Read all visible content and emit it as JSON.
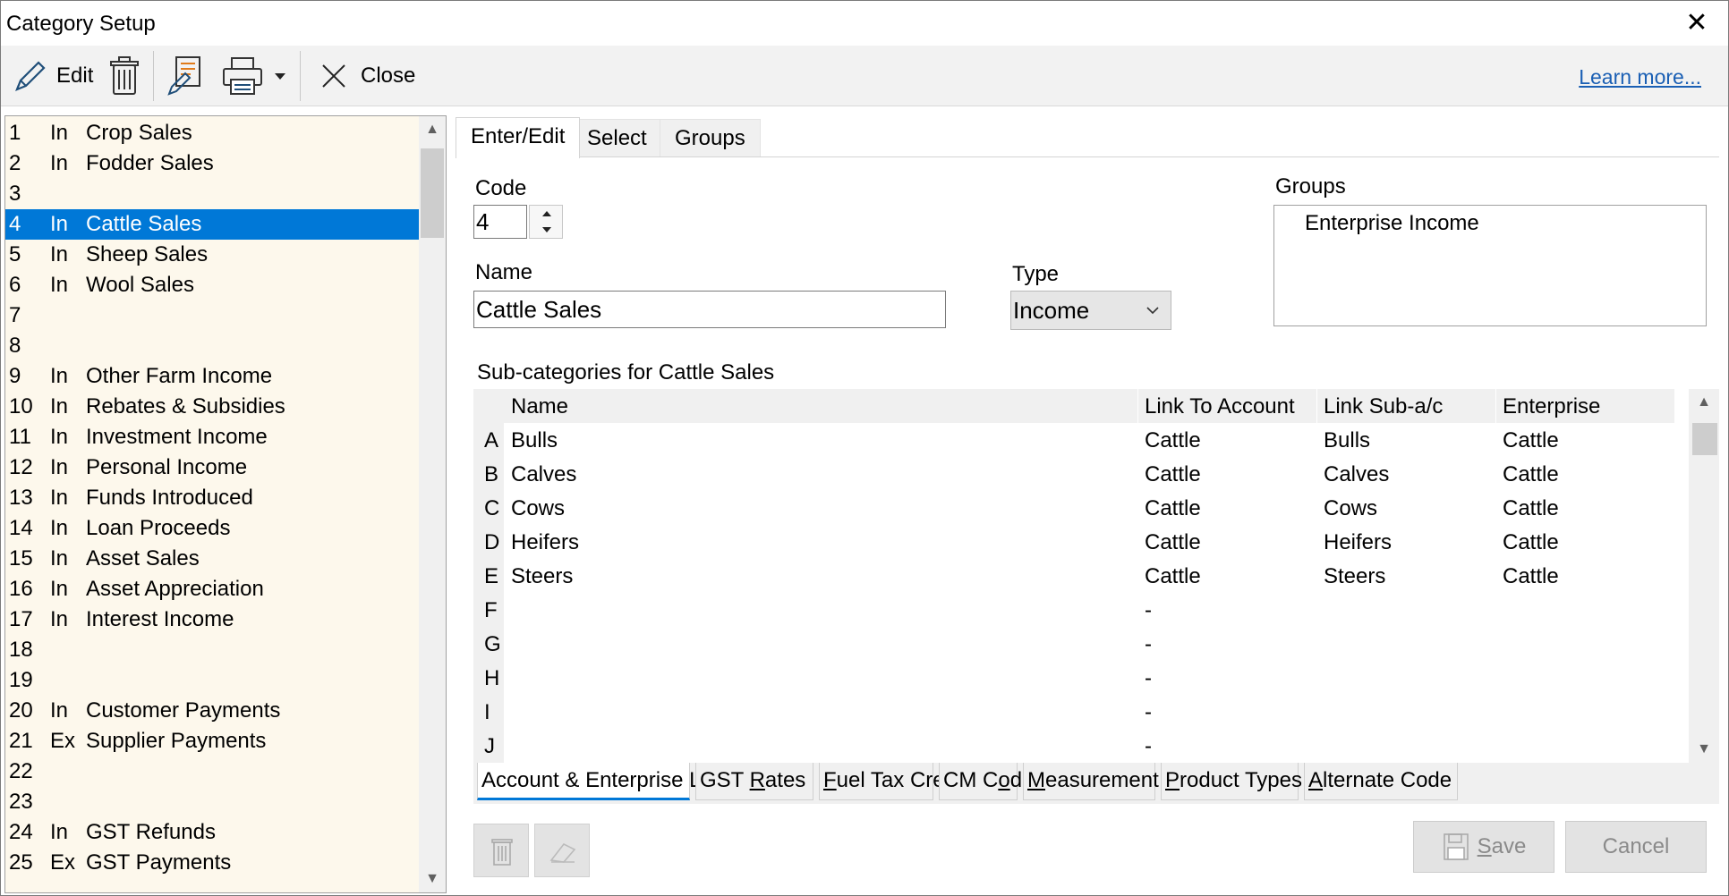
{
  "window": {
    "title": "Category Setup",
    "close_glyph": "✕"
  },
  "toolbar": {
    "edit_label": "Edit",
    "close_label": "Close",
    "learn_more": "Learn more..."
  },
  "categories": [
    {
      "num": "1",
      "type": "In",
      "name": "Crop Sales"
    },
    {
      "num": "2",
      "type": "In",
      "name": "Fodder Sales"
    },
    {
      "num": "3",
      "type": "",
      "name": ""
    },
    {
      "num": "4",
      "type": "In",
      "name": "Cattle Sales",
      "selected": true
    },
    {
      "num": "5",
      "type": "In",
      "name": "Sheep Sales"
    },
    {
      "num": "6",
      "type": "In",
      "name": "Wool Sales"
    },
    {
      "num": "7",
      "type": "",
      "name": ""
    },
    {
      "num": "8",
      "type": "",
      "name": ""
    },
    {
      "num": "9",
      "type": "In",
      "name": "Other Farm Income"
    },
    {
      "num": "10",
      "type": "In",
      "name": "Rebates & Subsidies"
    },
    {
      "num": "11",
      "type": "In",
      "name": "Investment Income"
    },
    {
      "num": "12",
      "type": "In",
      "name": "Personal Income"
    },
    {
      "num": "13",
      "type": "In",
      "name": "Funds Introduced"
    },
    {
      "num": "14",
      "type": "In",
      "name": "Loan Proceeds"
    },
    {
      "num": "15",
      "type": "In",
      "name": "Asset Sales"
    },
    {
      "num": "16",
      "type": "In",
      "name": "Asset Appreciation"
    },
    {
      "num": "17",
      "type": "In",
      "name": "Interest Income"
    },
    {
      "num": "18",
      "type": "",
      "name": ""
    },
    {
      "num": "19",
      "type": "",
      "name": ""
    },
    {
      "num": "20",
      "type": "In",
      "name": "Customer Payments"
    },
    {
      "num": "21",
      "type": "Ex",
      "name": "Supplier Payments"
    },
    {
      "num": "22",
      "type": "",
      "name": ""
    },
    {
      "num": "23",
      "type": "",
      "name": ""
    },
    {
      "num": "24",
      "type": "In",
      "name": "GST Refunds"
    },
    {
      "num": "25",
      "type": "Ex",
      "name": "GST Payments"
    }
  ],
  "tabs": [
    "Enter/Edit",
    "Select",
    "Groups"
  ],
  "form": {
    "code_label": "Code",
    "code_value": "4",
    "name_label": "Name",
    "name_value": "Cattle Sales",
    "type_label": "Type",
    "type_value": "Income",
    "groups_label": "Groups",
    "groups": [
      "Enterprise Income"
    ],
    "subcat_title": "Sub-categories for Cattle Sales"
  },
  "grid": {
    "headers": [
      "Name",
      "Link To Account",
      "Link Sub-a/c",
      "Enterprise"
    ],
    "rows": [
      {
        "letter": "A",
        "name": "Bulls",
        "account": "Cattle",
        "sub": "Bulls",
        "enterprise": "Cattle"
      },
      {
        "letter": "B",
        "name": "Calves",
        "account": "Cattle",
        "sub": "Calves",
        "enterprise": "Cattle"
      },
      {
        "letter": "C",
        "name": "Cows",
        "account": "Cattle",
        "sub": "Cows",
        "enterprise": "Cattle"
      },
      {
        "letter": "D",
        "name": "Heifers",
        "account": "Cattle",
        "sub": "Heifers",
        "enterprise": "Cattle"
      },
      {
        "letter": "E",
        "name": "Steers",
        "account": "Cattle",
        "sub": "Steers",
        "enterprise": "Cattle"
      },
      {
        "letter": "F",
        "name": "",
        "account": "-",
        "sub": "",
        "enterprise": ""
      },
      {
        "letter": "G",
        "name": "",
        "account": "-",
        "sub": "",
        "enterprise": ""
      },
      {
        "letter": "H",
        "name": "",
        "account": "-",
        "sub": "",
        "enterprise": ""
      },
      {
        "letter": "I",
        "name": "",
        "account": "-",
        "sub": "",
        "enterprise": ""
      },
      {
        "letter": "J",
        "name": "",
        "account": "-",
        "sub": "",
        "enterprise": ""
      }
    ]
  },
  "bottom_tabs": [
    {
      "pre": "Account & Enterprise Links",
      "ul": "",
      "post": ""
    },
    {
      "pre": "GST ",
      "ul": "R",
      "post": "ates"
    },
    {
      "pre": "",
      "ul": "F",
      "post": "uel Tax Credit"
    },
    {
      "pre": "CM C",
      "ul": "o",
      "post": "de"
    },
    {
      "pre": "",
      "ul": "M",
      "post": "easurement"
    },
    {
      "pre": "",
      "ul": "P",
      "post": "roduct Types"
    },
    {
      "pre": "",
      "ul": "A",
      "post": "lternate Code"
    }
  ],
  "buttons": {
    "save_ul": "S",
    "save_rest": "ave",
    "cancel": "Cancel"
  },
  "colors": {
    "selection": "#0078d7",
    "list_bg": "#fdf8ec",
    "link": "#1a5fb4"
  }
}
